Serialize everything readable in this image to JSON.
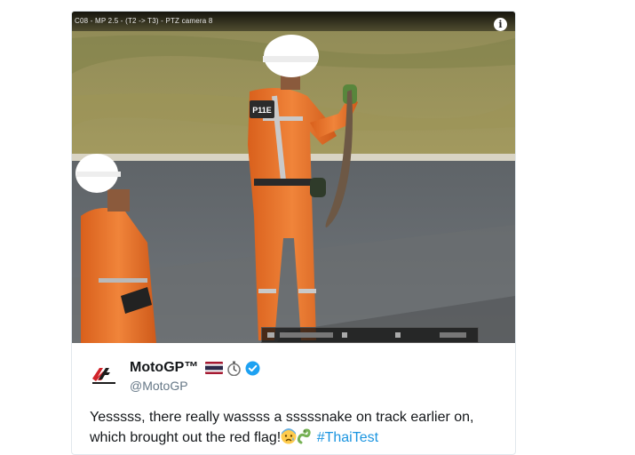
{
  "media": {
    "camera_label": "C08 - MP 2.5 - (T2 -> T3) - PTZ camera 8",
    "info_icon": "info-icon",
    "marshal_badge": "P11E"
  },
  "tweet": {
    "author_name": "MotoGP™",
    "author_emojis": [
      "thailand-flag-icon",
      "stopwatch-icon",
      "verified-badge-icon"
    ],
    "author_handle": "@MotoGP",
    "text_part1": "Yesssss, there really wassss a sssssnake on track earlier on, which brought out the red flag!",
    "text_emojis": [
      "anxious-face-icon",
      "snake-icon"
    ],
    "hashtag": "#ThaiTest"
  },
  "colors": {
    "hashtag": "#1b95e0",
    "verified": "#1da1f2",
    "suit_orange": "#e8752a",
    "motogp_red": "#d1232a"
  }
}
